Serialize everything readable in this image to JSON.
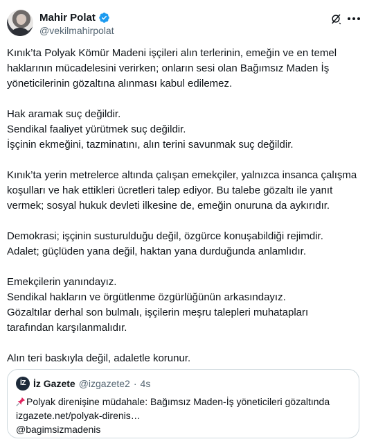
{
  "author": {
    "name": "Mahir Polat",
    "handle": "@vekilmahirpolat",
    "verified_color": "#1d9bf0"
  },
  "icons": {
    "avatar": "avatar-photo",
    "verified": "verified-badge-icon",
    "grok": "grok-icon",
    "more": "more-options-icon"
  },
  "tweet": {
    "paragraphs": [
      {
        "lines": [
          "Kınık’ta Polyak Kömür Madeni işçileri alın terlerinin, emeğin ve en temel",
          "haklarının mücadelesini verirken; onların sesi olan Bağımsız Maden İş",
          "yöneticilerinin gözaltına alınması kabul edilemez."
        ]
      },
      {
        "lines": [
          "Hak aramak suç değildir.",
          "Sendikal faaliyet yürütmek suç değildir.",
          "İşçinin ekmeğini, tazminatını, alın terini savunmak suç değildir."
        ]
      },
      {
        "lines": [
          "Kınık’ta yerin metrelerce altında çalışan emekçiler, yalnızca insanca çalışma",
          "koşulları ve hak ettikleri ücretleri talep ediyor. Bu talebe gözaltı ile yanıt",
          "vermek; sosyal hukuk devleti ilkesine de, emeğin onuruna da aykırıdır."
        ]
      },
      {
        "lines": [
          "Demokrasi; işçinin susturulduğu değil, özgürce konuşabildiği rejimdir.",
          "Adalet; güçlüden yana değil, haktan yana durduğunda anlamlıdır."
        ]
      },
      {
        "lines": [
          "Emekçilerin yanındayız.",
          "Sendikal hakların ve örgütlenme özgürlüğünün arkasındayız.",
          "Gözaltılar derhal son bulmalı, işçilerin meşru talepleri muhatapları",
          "tarafından karşılanmalıdır."
        ]
      },
      {
        "lines": [
          "Alın teri baskıyla değil, adaletle korunur."
        ]
      }
    ]
  },
  "quote": {
    "logo_text": "İZ",
    "name": "İz Gazete",
    "handle": "@izgazete2",
    "separator": "·",
    "time": "4s",
    "pin_icon": "pushpin-icon",
    "lines": [
      "Polyak direnişine müdahale: Bağımsız Maden-İş yöneticileri gözaltında",
      "izgazete.net/polyak-direnis…",
      "@bagimsizmadenis"
    ]
  }
}
